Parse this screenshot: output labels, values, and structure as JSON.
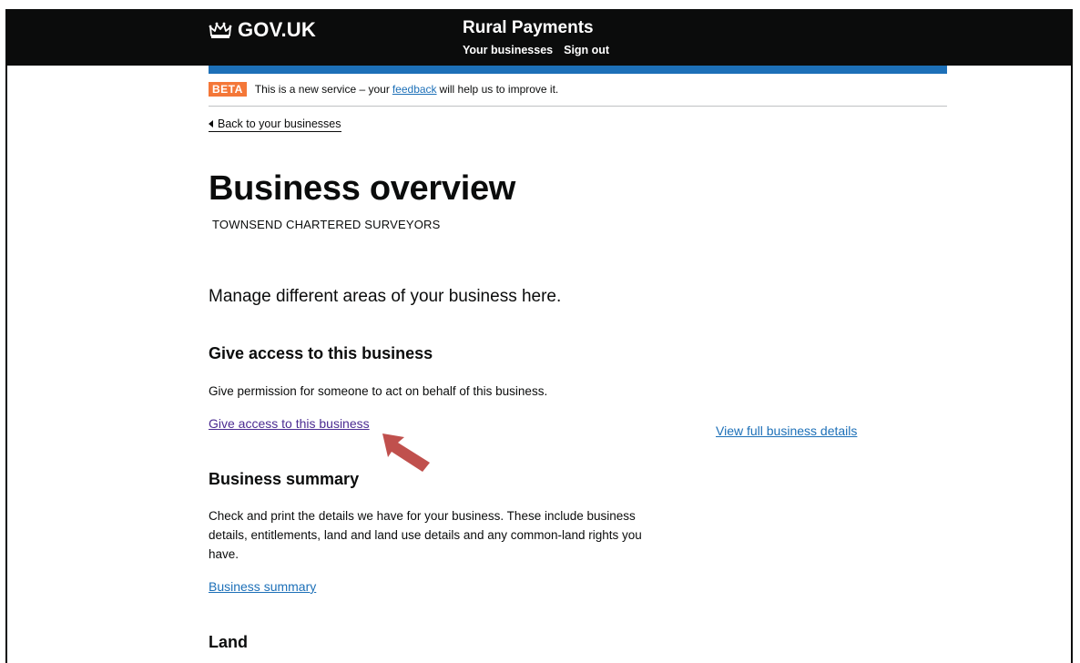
{
  "header": {
    "logo_text": "GOV.UK",
    "service_name": "Rural Payments",
    "nav": [
      "Your businesses",
      "Sign out"
    ]
  },
  "phase_banner": {
    "tag": "BETA",
    "text_before": "This is a new service – your",
    "link": "feedback",
    "text_after": "will help us to improve it."
  },
  "back_link": "Back to your businesses",
  "page": {
    "title": "Business overview",
    "business_name": "TOWNSEND CHARTERED SURVEYORS",
    "lead": "Manage different areas of your business here."
  },
  "sections": {
    "access": {
      "heading": "Give access to this business",
      "body": "Give permission for someone to act on behalf of this business.",
      "link": "Give access to this business"
    },
    "details_link": "View full business details",
    "summary": {
      "heading": "Business summary",
      "body": "Check and print the details we have for your business. These include business details, entitlements, land and land use details and any common-land rights you have.",
      "link": "Business summary"
    },
    "land": {
      "heading": "Land"
    }
  },
  "colors": {
    "header_bg": "#0b0c0c",
    "accent_blue": "#1d70b8",
    "beta_tag": "#f47738",
    "visited_link": "#4c2c92",
    "annotation_arrow": "#c0504d"
  },
  "icons": {
    "logo": "crown-icon",
    "back": "triangle-left-icon",
    "annotation": "arrow-pointer-icon"
  }
}
